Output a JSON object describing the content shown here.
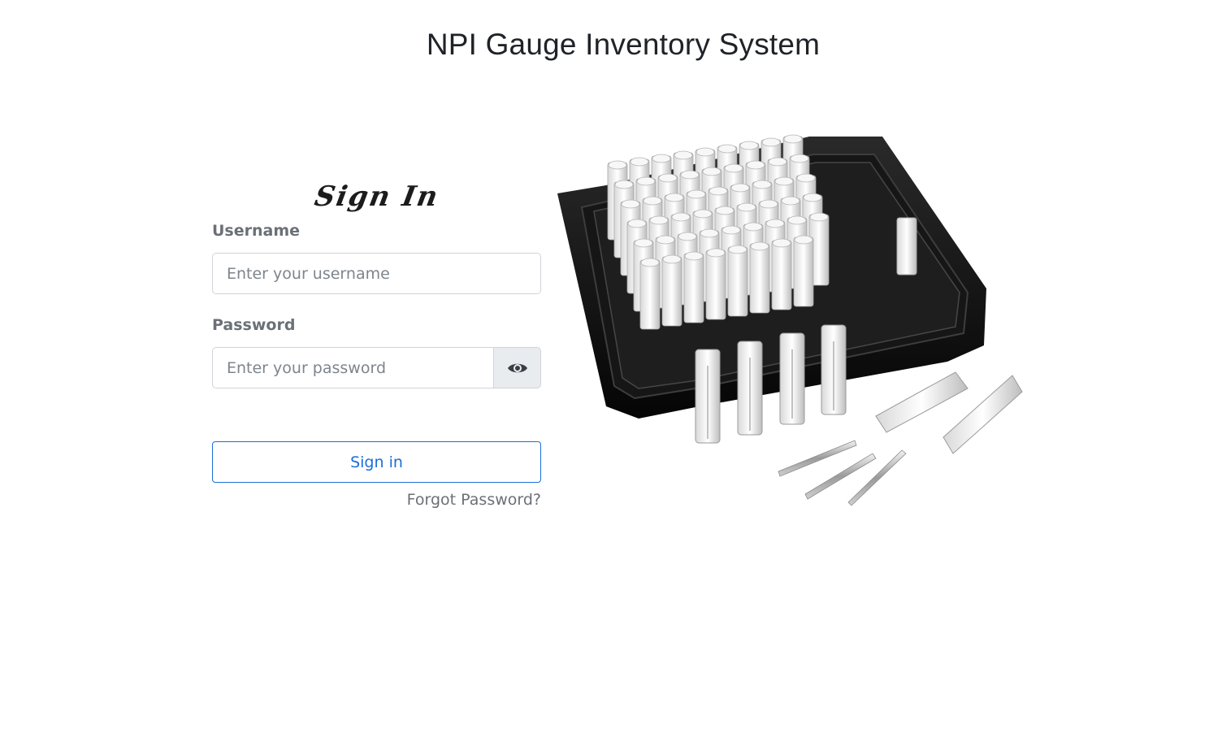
{
  "header": {
    "title": "NPI Gauge Inventory System"
  },
  "signin": {
    "heading": "Sign In",
    "username_label": "Username",
    "username_placeholder": "Enter your username",
    "username_value": "",
    "password_label": "Password",
    "password_placeholder": "Enter your password",
    "password_value": "",
    "toggle_icon": "eye-icon",
    "submit_label": "Sign in",
    "forgot_label": "Forgot Password?"
  },
  "colors": {
    "accent": "#1a6fd9",
    "label_text": "#6b7077",
    "input_border": "#cfd4da",
    "toggle_bg": "#e9ecef"
  },
  "image": {
    "subject": "pin gauge set in black storage case"
  }
}
